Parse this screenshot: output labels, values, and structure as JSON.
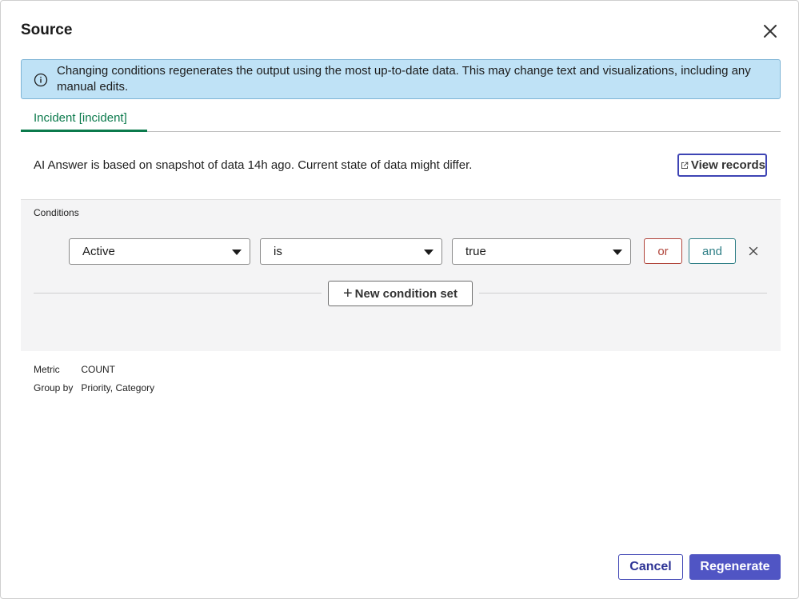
{
  "dialog": {
    "title": "Source",
    "alert_text": "Changing conditions regenerates the output using the most up-to-date data. This may change text and visualizations, including any manual edits."
  },
  "tabs": [
    {
      "label": "Incident [incident]",
      "active": true
    }
  ],
  "snapshot": {
    "text": "AI Answer is based on snapshot of data 14h ago. Current state of data might differ.",
    "view_records_label": "View records"
  },
  "conditions": {
    "label": "Conditions",
    "rows": [
      {
        "field": "Active",
        "operator": "is",
        "value": "true"
      }
    ],
    "or_label": "or",
    "and_label": "and",
    "new_condition_set_label": "New condition set"
  },
  "metadata": [
    {
      "key": "Metric",
      "value": "COUNT"
    },
    {
      "key": "Group by",
      "value": "Priority, Category"
    }
  ],
  "footer": {
    "cancel_label": "Cancel",
    "regenerate_label": "Regenerate"
  },
  "colors": {
    "accent": "#5055c4",
    "tab_active": "#0b7a4c",
    "alert_bg": "#bfe2f6",
    "or_color": "#b0443a",
    "and_color": "#2f7f86"
  },
  "icons": {
    "close": "close-icon",
    "info": "info-icon",
    "external_link": "external-link-icon",
    "remove": "remove-condition-icon",
    "plus": "plus-icon",
    "caret": "chevron-down-icon"
  }
}
